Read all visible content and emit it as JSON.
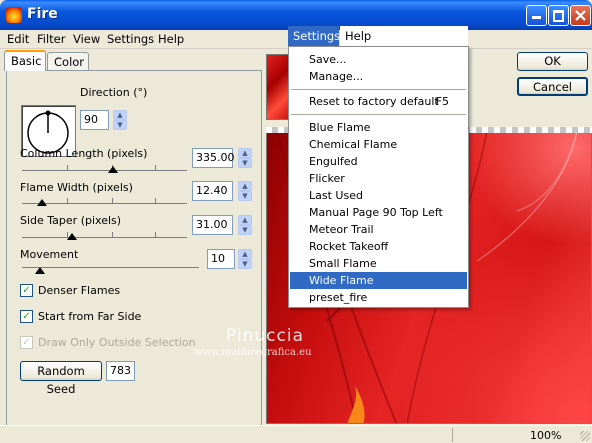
{
  "window": {
    "title": "Fire"
  },
  "menubar": [
    "Edit",
    "Filter",
    "View",
    "Settings",
    "Help"
  ],
  "tabs": [
    "Basic",
    "Color"
  ],
  "direction": {
    "label": "Direction (°)",
    "value": "90"
  },
  "column_length": {
    "label": "Column Length (pixels)",
    "value": "335.00",
    "level": 0.55
  },
  "flame_width": {
    "label": "Flame Width (pixels)",
    "value": "12.40",
    "level": 0.12
  },
  "side_taper": {
    "label": "Side Taper (pixels)",
    "value": "31.00",
    "level": 0.3
  },
  "movement": {
    "label": "Movement",
    "value": "10",
    "level": 0.1
  },
  "checkboxes": {
    "denser": {
      "label": "Denser Flames",
      "checked": true
    },
    "far_side": {
      "label": "Start from Far Side",
      "checked": true
    },
    "outside": {
      "label": "Draw Only Outside Selection",
      "checked": true,
      "disabled": true
    }
  },
  "random_seed": {
    "label": "Random Seed",
    "value": "783"
  },
  "buttons": {
    "ok": "OK",
    "cancel": "Cancel"
  },
  "settings_menu": {
    "label": "Settings",
    "help_label": "Help",
    "top_items": [
      "Save...",
      "Manage..."
    ],
    "reset": {
      "label": "Reset to factory default",
      "shortcut": "F5"
    },
    "presets": [
      "Blue Flame",
      "Chemical Flame",
      "Engulfed",
      "Flicker",
      "Last Used",
      "Manual Page 90 Top Left",
      "Meteor Trail",
      "Rocket Takeoff",
      "Small Flame",
      "Wide Flame",
      "preset_fire"
    ],
    "highlighted": "Wide Flame"
  },
  "watermark": {
    "name": "Pinuccia",
    "url": "www.maidiregrafica.eu"
  },
  "status": {
    "zoom": "100%"
  },
  "colors": {
    "accent": "#316ac5",
    "titlebar": "#0855dd",
    "flame": "#d41616"
  }
}
